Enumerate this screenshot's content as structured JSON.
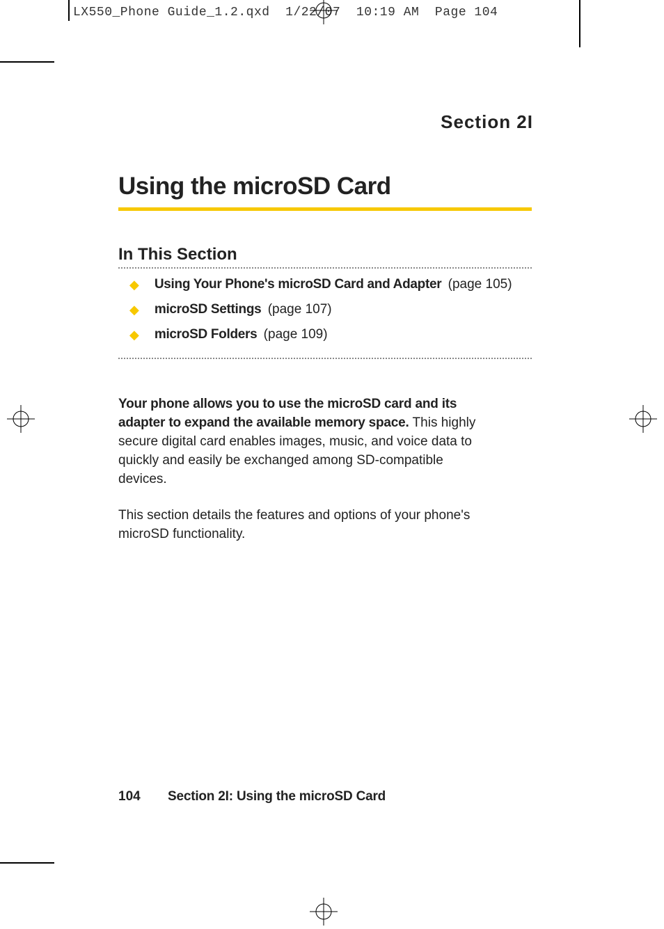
{
  "header": {
    "filename": "LX550_Phone Guide_1.2.qxd",
    "date": "1/22/07",
    "time": "10:19 AM",
    "pagelabel": "Page 104"
  },
  "section_label": "Section 2I",
  "main_title": "Using the microSD Card",
  "subsection_title": "In This Section",
  "toc": [
    {
      "title": "Using Your Phone's microSD Card and Adapter",
      "page": "(page 105)"
    },
    {
      "title": "microSD Settings",
      "page": "(page 107)"
    },
    {
      "title": "microSD Folders",
      "page": "(page 109)"
    }
  ],
  "body": {
    "para1_bold": "Your phone allows you to use the microSD card and its adapter to expand the available memory space.",
    "para1_rest": " This highly secure digital card enables images, music, and voice data to quickly and easily be exchanged among SD-compatible devices.",
    "para2": "This section details the features and options of your phone's microSD functionality."
  },
  "footer": {
    "pagenum": "104",
    "text": "Section 2I: Using the microSD Card"
  }
}
